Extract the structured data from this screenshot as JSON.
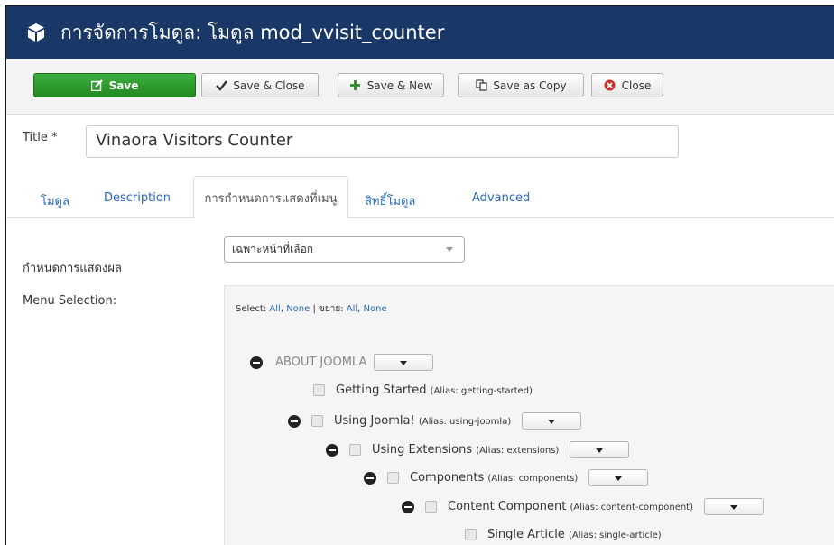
{
  "header": {
    "title": "การจัดการโมดูล: โมดูล mod_vvisit_counter",
    "brand_color": "#1a3867"
  },
  "toolbar": {
    "save_label": "Save",
    "save_close_label": "Save & Close",
    "save_new_label": "Save & New",
    "save_copy_label": "Save as Copy",
    "close_label": "Close"
  },
  "form": {
    "title_label": "Title *",
    "title_value": "Vinaora Visitors Counter"
  },
  "tabs": [
    {
      "label": "โมดูล"
    },
    {
      "label": "Description"
    },
    {
      "label": "การกำหนดการแสดงที่เมนู"
    },
    {
      "label": "สิทธิ์โมดูล"
    },
    {
      "label": "Advanced"
    }
  ],
  "assignment": {
    "label": "กำหนดการแสดงผล",
    "selected": "เฉพาะหน้าที่เลือก"
  },
  "menu_selection": {
    "label": "Menu Selection:",
    "select_prefix": "Select:",
    "all": "All",
    "comma": ",",
    "none": "None",
    "separator": "|",
    "expand_prefix": "ขยาย:",
    "all2": "All",
    "comma2": ",",
    "none2": "None",
    "root": "ABOUT JOOMLA",
    "items": [
      {
        "label": "Getting Started",
        "alias": "(Alias: getting-started)"
      },
      {
        "label": "Using Joomla!",
        "alias": "(Alias: using-joomla)"
      },
      {
        "label": "Using Extensions",
        "alias": "(Alias: extensions)"
      },
      {
        "label": "Components",
        "alias": "(Alias: components)"
      },
      {
        "label": "Content Component",
        "alias": "(Alias: content-component)"
      },
      {
        "label": "Single Article",
        "alias": "(Alias: single-article)"
      }
    ]
  }
}
